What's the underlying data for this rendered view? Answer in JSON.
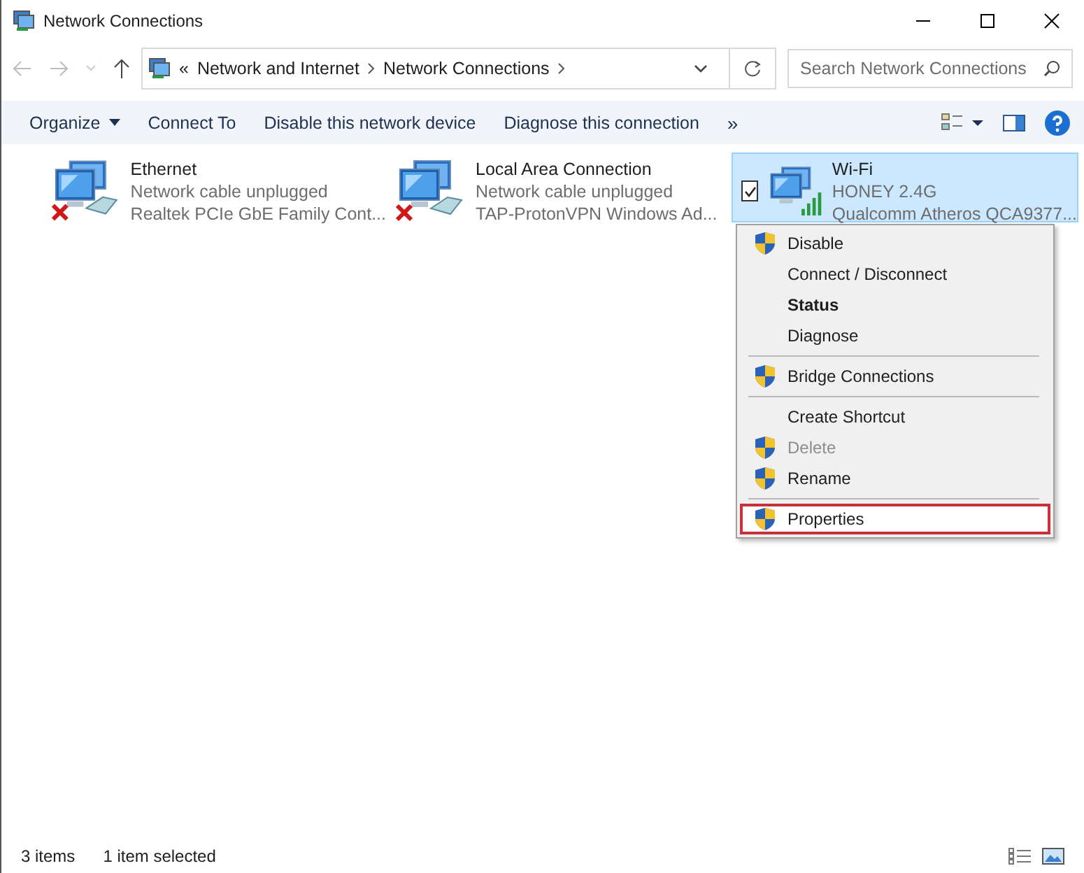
{
  "window": {
    "title": "Network Connections"
  },
  "address": {
    "overflow": "«",
    "segments": [
      "Network and Internet",
      "Network Connections"
    ]
  },
  "search": {
    "placeholder": "Search Network Connections"
  },
  "toolbar": {
    "items": [
      {
        "label": "Organize",
        "dropdown": true
      },
      {
        "label": "Connect To",
        "dropdown": false
      },
      {
        "label": "Disable this network device",
        "dropdown": false
      },
      {
        "label": "Diagnose this connection",
        "dropdown": false
      }
    ],
    "more": "»"
  },
  "connections": [
    {
      "kind": "wired",
      "name": "Ethernet",
      "status": "Network cable unplugged",
      "device": "Realtek PCIe GbE Family Cont...",
      "connected": false,
      "selected": false
    },
    {
      "kind": "wired",
      "name": "Local Area Connection",
      "status": "Network cable unplugged",
      "device": "TAP-ProtonVPN Windows Ad...",
      "connected": false,
      "selected": false
    },
    {
      "kind": "wifi",
      "name": "Wi-Fi",
      "status": "HONEY 2.4G",
      "device": "Qualcomm Atheros QCA9377...",
      "connected": true,
      "selected": true
    }
  ],
  "context_menu": {
    "groups": [
      [
        {
          "label": "Disable",
          "shield": true,
          "default": false,
          "disabled": false,
          "selected": false
        },
        {
          "label": "Connect / Disconnect",
          "shield": false,
          "default": false,
          "disabled": false,
          "selected": false
        },
        {
          "label": "Status",
          "shield": false,
          "default": true,
          "disabled": false,
          "selected": false
        },
        {
          "label": "Diagnose",
          "shield": false,
          "default": false,
          "disabled": false,
          "selected": false
        }
      ],
      [
        {
          "label": "Bridge Connections",
          "shield": true,
          "default": false,
          "disabled": false,
          "selected": false
        }
      ],
      [
        {
          "label": "Create Shortcut",
          "shield": false,
          "default": false,
          "disabled": false,
          "selected": false
        },
        {
          "label": "Delete",
          "shield": true,
          "default": false,
          "disabled": true,
          "selected": false
        },
        {
          "label": "Rename",
          "shield": true,
          "default": false,
          "disabled": false,
          "selected": false
        }
      ],
      [
        {
          "label": "Properties",
          "shield": true,
          "default": false,
          "disabled": false,
          "selected": true
        }
      ]
    ]
  },
  "status_bar": {
    "count": "3 items",
    "selection": "1 item selected"
  }
}
